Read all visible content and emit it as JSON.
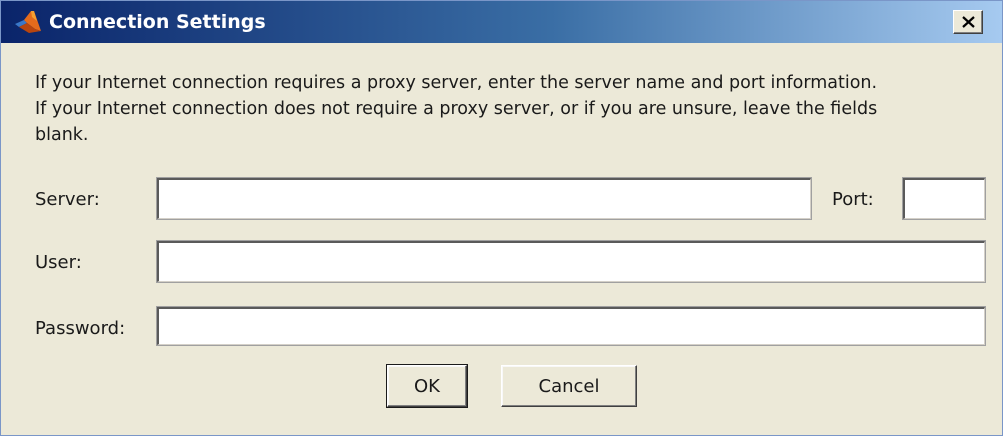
{
  "window": {
    "title": "Connection Settings",
    "colors": {
      "titlebar_start": "#0a246a",
      "titlebar_end": "#a6caf0",
      "background": "#ece9d8"
    }
  },
  "titlebar": {
    "icon": "matlab-logo-icon",
    "close_icon": "close-icon"
  },
  "message": {
    "line1": "If your Internet connection requires a proxy server, enter the server name and port information.",
    "line2": "If your Internet connection does not require a proxy server, or if you are unsure, leave the fields",
    "line3": "blank."
  },
  "form": {
    "server_label": "Server:",
    "server_value": "",
    "port_label": "Port:",
    "port_value": "",
    "user_label": "User:",
    "user_value": "",
    "password_label": "Password:",
    "password_value": ""
  },
  "buttons": {
    "ok_label": "OK",
    "cancel_label": "Cancel"
  }
}
